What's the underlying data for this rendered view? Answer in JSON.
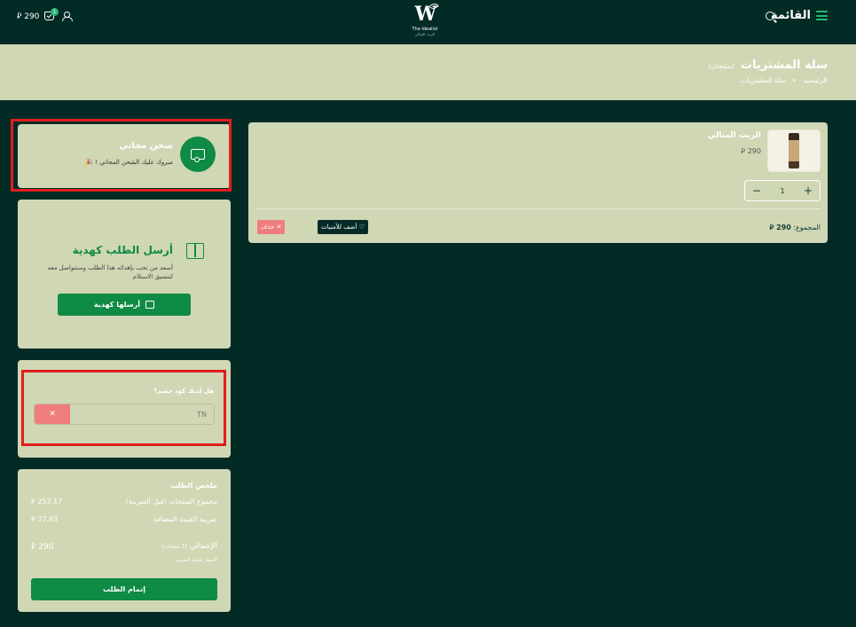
{
  "header": {
    "menu_label": "القائمة",
    "brand_name": "The Idealist",
    "brand_sub": "الزيت المثالي",
    "cart_badge": "1",
    "cart_total": "290 ⃁"
  },
  "page": {
    "title": "سلة المشتريات",
    "count_label": "(منتجان)",
    "breadcrumbs": [
      "الرئيسية",
      "سلة المشتريات"
    ]
  },
  "cart_item": {
    "name": "الزيت المثالي",
    "price": "290 ⃁",
    "quantity": "1",
    "plus": "+",
    "minus": "−",
    "subtotal_label": "المجموع:",
    "subtotal_value": "290 ⃁",
    "wishlist_label": "♡ أضف للأمنيات",
    "delete_label": "✕ حذف"
  },
  "shipping": {
    "title": "شحن مجاني",
    "subtitle": "مبروك عليك الشحن المجاني ! 🎉"
  },
  "gift": {
    "title": "أرسل الطلب كهدية",
    "description": "أسعد من تحب بإهدائه هذا الطلب وسنتواصل معه لتنسيق الاستلام",
    "button_label": "أرسلها كهدية"
  },
  "coupon": {
    "label": "هل لديك كود خصم؟",
    "value": "TN",
    "clear_label": "✕"
  },
  "summary": {
    "title": "ملخص الطلب",
    "subtotal_label": "مجموع المنتجات (قبل الضريبة)",
    "subtotal_value": "252.17 ⃁",
    "vat_label": "ضريبة القيمة المضافة",
    "vat_value": "37.83 ⃁",
    "total_label": "الإجمالي",
    "total_count": "(1 منتجات)",
    "total_value": "290 ⃁",
    "note": "الأسعار شاملة الضريبة",
    "checkout_label": "إتمام الطلب"
  },
  "colors": {
    "background": "#022b26",
    "card": "#d0d7b4",
    "accent": "#0f8b45",
    "danger": "#f07d7d",
    "highlight": "#e01e1e"
  }
}
